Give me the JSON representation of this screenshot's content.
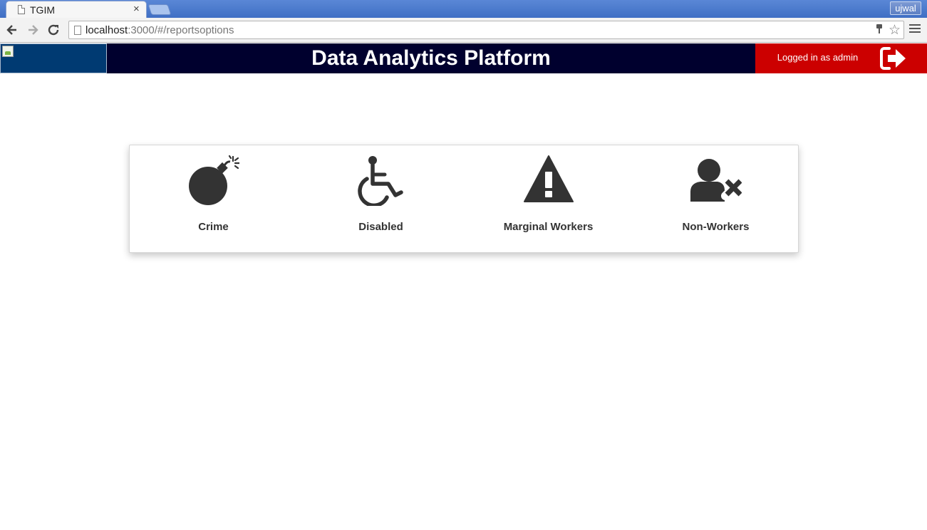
{
  "browser": {
    "tab_title": "TGIM",
    "tab_close": "×",
    "profile_name": "ujwal",
    "url_host": "localhost",
    "url_path": ":3000/#/reportsoptions"
  },
  "header": {
    "title": "Data Analytics Platform",
    "login_status": "Logged in as admin",
    "colors": {
      "title_bar": "#00002e",
      "logo_bg": "#003a72",
      "user_panel": "#cc0000"
    }
  },
  "report_options": [
    {
      "label": "Crime",
      "icon": "bomb-icon"
    },
    {
      "label": "Disabled",
      "icon": "wheelchair-icon"
    },
    {
      "label": "Marginal Workers",
      "icon": "warning-icon"
    },
    {
      "label": "Non-Workers",
      "icon": "user-times-icon"
    }
  ]
}
